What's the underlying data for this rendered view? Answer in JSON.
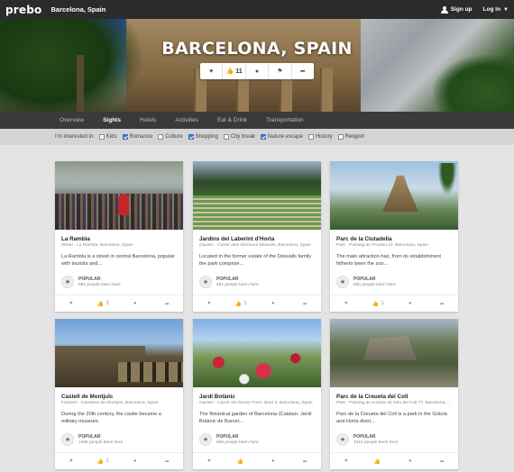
{
  "topbar": {
    "logo": "prebo",
    "location": "Barcelona, Spain",
    "signup": "Sign up",
    "login": "Log in"
  },
  "hero": {
    "title": "BARCELONA, SPAIN",
    "like_count": "11"
  },
  "tabs": [
    {
      "label": "Overview",
      "active": false
    },
    {
      "label": "Sights",
      "active": true
    },
    {
      "label": "Hotels",
      "active": false
    },
    {
      "label": "Activities",
      "active": false
    },
    {
      "label": "Eat & Drink",
      "active": false
    },
    {
      "label": "Transportation",
      "active": false
    }
  ],
  "interests": {
    "label": "I'm interested in:",
    "options": [
      {
        "label": "Kids",
        "checked": false
      },
      {
        "label": "Romance",
        "checked": true
      },
      {
        "label": "Culture",
        "checked": false
      },
      {
        "label": "Shopping",
        "checked": true
      },
      {
        "label": "City break",
        "checked": false
      },
      {
        "label": "Nature escape",
        "checked": true
      },
      {
        "label": "History",
        "checked": false
      },
      {
        "label": "Religion",
        "checked": false
      }
    ]
  },
  "cards": [
    {
      "title": "La Rambla",
      "meta": "Street · La Rambla, Barcelona, Spain",
      "desc": "La Rambla is a street in central Barcelona, popular with tourists and...",
      "popular": "POPULAR",
      "count": "891 people been here",
      "likes": "3",
      "photo": "rambla"
    },
    {
      "title": "Jardins del Laberint d'Horta",
      "meta": "Garden · Carrer dels Germans Desvalls, Barcelona, Spain",
      "desc": "Located in the former estate of the Desvalls family the park comprise...",
      "popular": "POPULAR",
      "count": "861 people been here",
      "likes": "1",
      "photo": "laberint"
    },
    {
      "title": "Parc de la Ciutadella",
      "meta": "Park · Passeig de Picasso 21, Barcelona, Spain",
      "desc": "The main attraction has, from its establishment hitherto been the zoo...",
      "popular": "POPULAR",
      "count": "830 people been here",
      "likes": "1",
      "photo": "ciutadella"
    },
    {
      "title": "Castell de Montjuïc",
      "meta": "Fortress · Carretera de Montjuïc, Barcelona, Spain",
      "desc": "During the 20th century, the castle became a military museum.",
      "popular": "POPULAR",
      "count": "1386 people been here",
      "likes": "1",
      "photo": "montjuic"
    },
    {
      "title": "Jardí Botànic",
      "meta": "Garden · Carrer del Doctor Font i Quer 2, Barcelona, Spain",
      "desc": "The Botanical garden of Barcelona (Catalan: Jardí Botànic de Barcel...",
      "popular": "POPULAR",
      "count": "860 people been here",
      "likes": "",
      "photo": "botanic"
    },
    {
      "title": "Parc de la Creueta del Coll",
      "meta": "Park · Passeig de la Mare de Déu del Coll 77, Barcelona, ...",
      "desc": "Parc de la Creueta del Coll is a park in the Gràcia and Horta distri...",
      "popular": "POPULAR",
      "count": "1019 people been here",
      "likes": "",
      "photo": "creueta"
    }
  ]
}
